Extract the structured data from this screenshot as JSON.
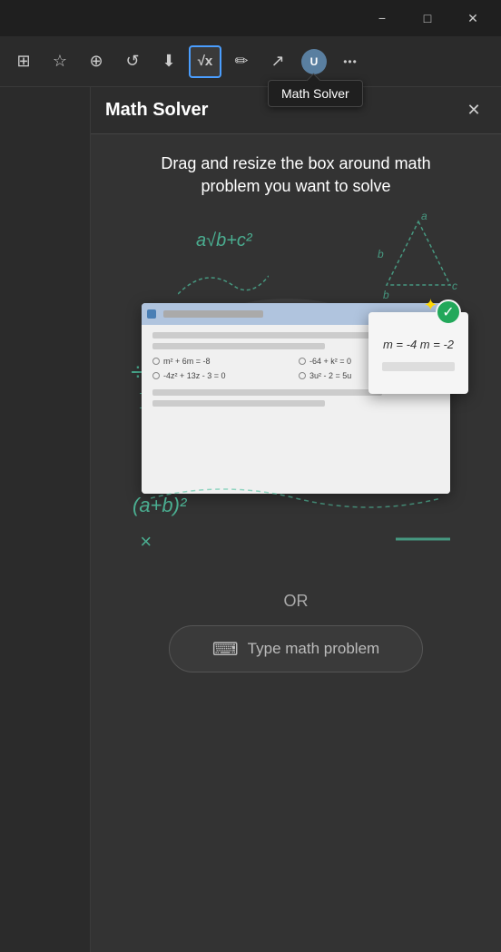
{
  "titlebar": {
    "minimize_label": "−",
    "maximize_label": "□",
    "close_label": "✕"
  },
  "toolbar": {
    "tooltip": "Math Solver",
    "buttons": [
      {
        "name": "extensions-icon",
        "icon": "⊞",
        "label": "Extensions"
      },
      {
        "name": "favorites-icon",
        "icon": "☆",
        "label": "Favorites"
      },
      {
        "name": "collections-icon",
        "icon": "⊕",
        "label": "Collections"
      },
      {
        "name": "history-icon",
        "icon": "↺",
        "label": "History"
      },
      {
        "name": "download-icon",
        "icon": "⬇",
        "label": "Downloads"
      },
      {
        "name": "math-solver-icon",
        "icon": "√x",
        "label": "Math Solver",
        "active": true
      },
      {
        "name": "inking-icon",
        "icon": "✏",
        "label": "Inking"
      },
      {
        "name": "share-icon",
        "icon": "↗",
        "label": "Share"
      },
      {
        "name": "more-icon",
        "icon": "•••",
        "label": "More"
      }
    ]
  },
  "panel": {
    "title": "Math Solver",
    "close_label": "✕",
    "instruction": "Drag and resize the box around math problem you want to solve",
    "or_label": "OR",
    "type_math_btn": "Type math problem"
  },
  "mockup": {
    "problems": [
      "m² + 6m = -8",
      "-64 + k² = 0",
      "-4z² + 13z - 3 = 0",
      "3u² - 2 = 5u"
    ],
    "solution": "m = -4\nm = -2"
  },
  "decorations": {
    "division_sign": "÷",
    "x_sign": "×",
    "formula1": "a√b+c²",
    "formula2": "(a+b)²"
  }
}
